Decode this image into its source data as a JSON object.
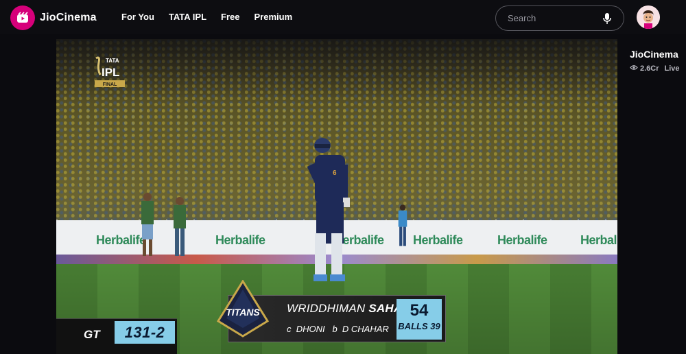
{
  "header": {
    "brand": "JioCinema",
    "nav": [
      "For You",
      "TATA IPL",
      "Free",
      "Premium"
    ],
    "search_placeholder": "Search"
  },
  "player": {
    "stream_logo_text": [
      "TATA",
      "IPL",
      "FINAL"
    ],
    "boards": [
      "Herbalife",
      "Herbalife",
      "Herbalife",
      "Herbalife",
      "Herbalife",
      "Herbalife"
    ],
    "scoreboard": {
      "team": "GT",
      "score": "131-2",
      "team_badge_text": "TITANS",
      "batter_first": "WRIDDHIMAN",
      "batter_last": "SAHA",
      "dismissal": "c  DHONI   b  D CHAHAR",
      "batter_runs": "54",
      "batter_balls": "BALLS 39"
    }
  },
  "sidebar": {
    "channel": "JioCinema",
    "views": "2.6Cr",
    "status": "Live"
  },
  "colors": {
    "brand": "#d6007a",
    "score_box": "#86cde8"
  }
}
